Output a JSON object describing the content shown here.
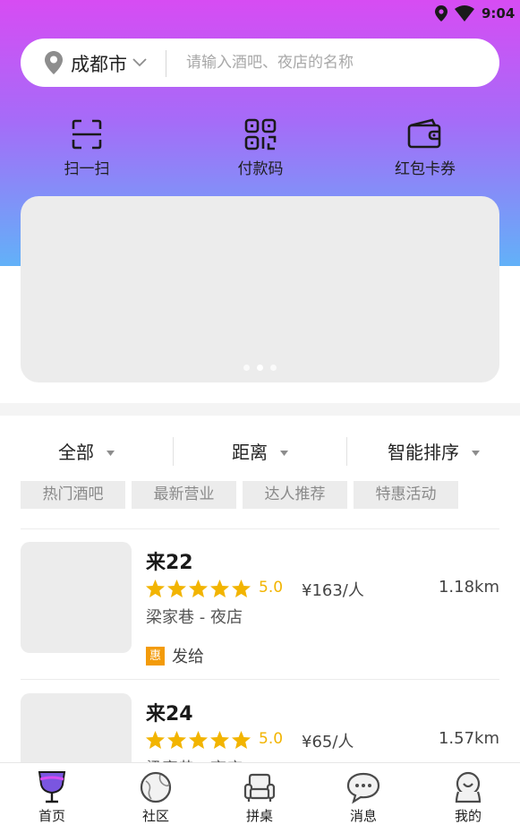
{
  "status_bar": {
    "time": "9:04"
  },
  "search": {
    "city": "成都市",
    "placeholder": "请输入酒吧、夜店的名称",
    "value": ""
  },
  "quick_actions": [
    {
      "label": "扫一扫",
      "icon": "scan-icon"
    },
    {
      "label": "付款码",
      "icon": "qr-code-icon"
    },
    {
      "label": "红包卡券",
      "icon": "wallet-icon"
    }
  ],
  "banner": {
    "page_count": 3,
    "active_index": 1
  },
  "filters": [
    {
      "label": "全部"
    },
    {
      "label": "距离"
    },
    {
      "label": "智能排序"
    }
  ],
  "chips": [
    "热门酒吧",
    "最新营业",
    "达人推荐",
    "特惠活动"
  ],
  "venues": [
    {
      "name": "来22",
      "stars": 5,
      "rating": "5.0",
      "price": "¥163/人",
      "distance": "1.18km",
      "location": "梁家巷 - 夜店",
      "promo_badge": "惠",
      "promo_text": "发给"
    },
    {
      "name": "来24",
      "stars": 5,
      "rating": "5.0",
      "price": "¥65/人",
      "distance": "1.57km",
      "location": "梁家巷 - 夜店"
    }
  ],
  "tabbar": [
    {
      "label": "首页",
      "icon": "wine-glass-icon",
      "active": true
    },
    {
      "label": "社区",
      "icon": "community-icon"
    },
    {
      "label": "拼桌",
      "icon": "sofa-icon"
    },
    {
      "label": "消息",
      "icon": "chat-bubble-icon"
    },
    {
      "label": "我的",
      "icon": "profile-icon"
    }
  ],
  "colors": {
    "gradient_top": "#d74cf3",
    "gradient_bottom": "#62b1f8",
    "star": "#f2b400",
    "promo": "#f39b0a"
  }
}
